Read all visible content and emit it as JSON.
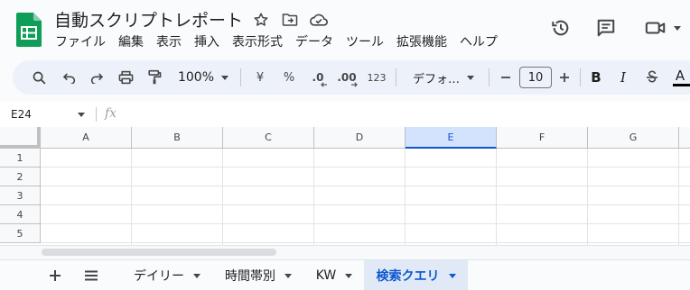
{
  "app": {
    "title": "自動スクリプトレポート",
    "menus": [
      "ファイル",
      "編集",
      "表示",
      "挿入",
      "表示形式",
      "データ",
      "ツール",
      "拡張機能",
      "ヘルプ"
    ]
  },
  "title_icons": [
    "star-icon",
    "move-to-folder-icon",
    "cloud-saved-icon"
  ],
  "header_actions": [
    "history-icon",
    "comments-icon",
    "meet-camera-icon"
  ],
  "toolbar": {
    "zoom": "100%",
    "currency": "¥",
    "percent": "%",
    "decrease_decimal": ".0",
    "increase_decimal": ".00",
    "number_format": "123",
    "font": "デフォ…",
    "font_size": "10",
    "bold": "B",
    "italic": "I",
    "text_color": "A"
  },
  "formula_bar": {
    "name_box": "E24",
    "fx": "fx",
    "value": ""
  },
  "grid": {
    "columns": [
      "A",
      "B",
      "C",
      "D",
      "E",
      "F",
      "G"
    ],
    "selected_column": "E",
    "rows": [
      "1",
      "2",
      "3",
      "4",
      "5"
    ]
  },
  "sheets": {
    "tabs": [
      {
        "label": "デイリー",
        "active": false
      },
      {
        "label": "時間帯別",
        "active": false
      },
      {
        "label": "KW",
        "active": false
      },
      {
        "label": "検索クエリ",
        "active": true
      }
    ]
  },
  "colors": {
    "accent": "#0b57d0",
    "toolbar_bg": "#edf2fa",
    "selected_header": "#d3e3fd",
    "active_tab": "#e1e9f7",
    "logo_green": "#0f9d58"
  }
}
